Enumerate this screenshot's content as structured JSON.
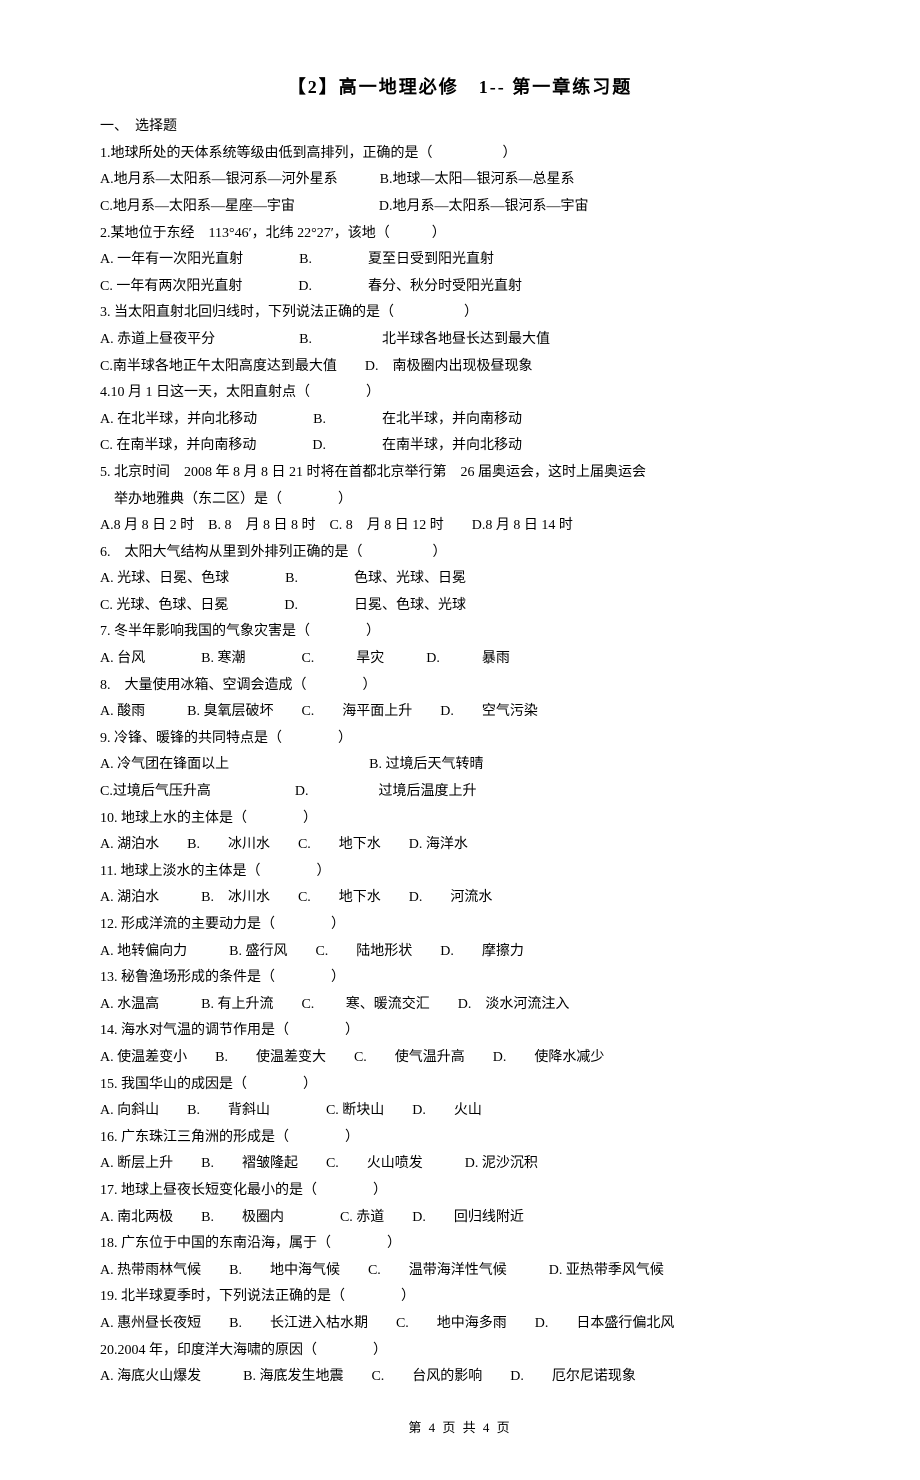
{
  "title": "【2】高一地理必修　1-- 第一章练习题",
  "section": "一、　选择题",
  "questions": [
    {
      "stem": "1.地球所处的天体系统等级由低到高排列，正确的是（　　　　　）",
      "lines": [
        "A.地月系—太阳系—银河系—河外星系　　　B.地球—太阳—银河系—总星系",
        "C.地月系—太阳系—星座—宇宙　　　　　　D.地月系—太阳系—银河系—宇宙"
      ]
    },
    {
      "stem": "2.某地位于东经　113°46′，北纬 22°27′，该地（　　　）",
      "lines": [
        "A. 一年有一次阳光直射　　　　B.　　　　夏至日受到阳光直射",
        "C. 一年有两次阳光直射　　　　D.　　　　春分、秋分时受阳光直射"
      ]
    },
    {
      "stem": "3. 当太阳直射北回归线时，下列说法正确的是（　　　　　）",
      "lines": [
        "A. 赤道上昼夜平分　　　　　　B.　　　　　北半球各地昼长达到最大值",
        "C.南半球各地正午太阳高度达到最大值　　D.　南极圈内出现极昼现象"
      ]
    },
    {
      "stem": "4.10 月 1 日这一天，太阳直射点（　　　　）",
      "lines": [
        "A. 在北半球，并向北移动　　　　B.　　　　在北半球，并向南移动",
        "C. 在南半球，并向南移动　　　　D.　　　　在南半球，并向北移动"
      ]
    },
    {
      "stem": "5. 北京时间　2008 年 8 月 8 日 21 时将在首都北京举行第　26 届奥运会，这时上届奥运会",
      "lines": [
        "　举办地雅典（东二区）是（　　　　）",
        "A.8 月 8 日 2 时　B. 8　月 8 日 8 时　C. 8　月 8 日 12 时　　D.8 月 8 日 14 时"
      ]
    },
    {
      "stem": "6.　太阳大气结构从里到外排列正确的是（　　　　　）",
      "lines": [
        "A. 光球、日冕、色球　　　　B.　　　　色球、光球、日冕",
        "C. 光球、色球、日冕　　　　D.　　　　日冕、色球、光球"
      ]
    },
    {
      "stem": "7. 冬半年影响我国的气象灾害是（　　　　）",
      "lines": [
        "A. 台风　　　　B. 寒潮　　　　C.　　　旱灾　　　D.　　　暴雨"
      ]
    },
    {
      "stem": "8.　大量使用冰箱、空调会造成（　　　　）",
      "lines": [
        "A. 酸雨　　　B. 臭氧层破坏　　C.　　海平面上升　　D.　　空气污染"
      ]
    },
    {
      "stem": "9. 冷锋、暖锋的共同特点是（　　　　）",
      "lines": [
        "A. 冷气团在锋面以上　　　　　　　　　　B. 过境后天气转晴",
        "C.过境后气压升高　　　　　　D.　　　　　过境后温度上升"
      ]
    },
    {
      "stem": "10. 地球上水的主体是（　　　　）",
      "lines": [
        "A. 湖泊水　　B.　　冰川水　　C.　　地下水　　D. 海洋水"
      ]
    },
    {
      "stem": "11. 地球上淡水的主体是（　　　　）",
      "lines": [
        "A. 湖泊水　　　B.　冰川水　　C.　　地下水　　D.　　河流水"
      ]
    },
    {
      "stem": "12. 形成洋流的主要动力是（　　　　）",
      "lines": [
        "A. 地转偏向力　　　B. 盛行风　　C.　　陆地形状　　D.　　摩擦力"
      ]
    },
    {
      "stem": "13. 秘鲁渔场形成的条件是（　　　　）",
      "lines": [
        "A. 水温高　　　B. 有上升流　　C.　　 寒、暖流交汇　　D.　淡水河流注入"
      ]
    },
    {
      "stem": "14. 海水对气温的调节作用是（　　　　）",
      "lines": [
        "A. 使温差变小　　B.　　使温差变大　　C.　　使气温升高　　D.　　使降水减少"
      ]
    },
    {
      "stem": "15. 我国华山的成因是（　　　　）",
      "lines": [
        "A. 向斜山　　B.　　背斜山　　　　C. 断块山　　D.　　火山"
      ]
    },
    {
      "stem": "16. 广东珠江三角洲的形成是（　　　　）",
      "lines": [
        "A. 断层上升　　B.　　褶皱隆起　　C.　　火山喷发　　　D. 泥沙沉积"
      ]
    },
    {
      "stem": "17. 地球上昼夜长短变化最小的是（　　　　）",
      "lines": [
        "A. 南北两极　　B.　　极圈内　　　　C. 赤道　　D.　　回归线附近"
      ]
    },
    {
      "stem": "18. 广东位于中国的东南沿海，属于（　　　　）",
      "lines": [
        "A. 热带雨林气候　　B.　　地中海气候　　C.　　温带海洋性气候　　　D. 亚热带季风气候"
      ]
    },
    {
      "stem": "19. 北半球夏季时，下列说法正确的是（　　　　）",
      "lines": [
        "A. 惠州昼长夜短　　B.　　长江进入枯水期　　C.　　地中海多雨　　D.　　日本盛行偏北风"
      ]
    },
    {
      "stem": "20.2004 年，印度洋大海啸的原因（　　　　）",
      "lines": [
        "A. 海底火山爆发　　　B. 海底发生地震　　C.　　台风的影响　　D.　　厄尔尼诺现象"
      ]
    }
  ],
  "footer": "第 4 页 共 4 页"
}
